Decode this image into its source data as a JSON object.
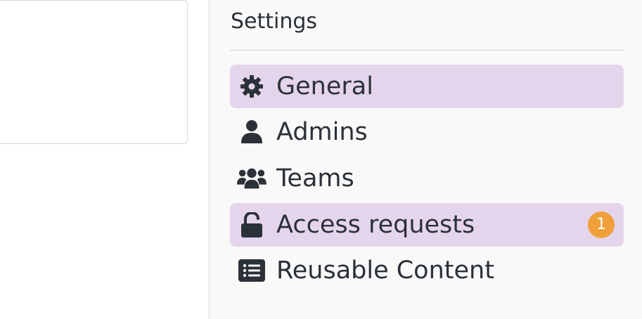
{
  "sidebar": {
    "title": "Settings",
    "items": [
      {
        "label": "General",
        "icon": "gear-icon",
        "active": true
      },
      {
        "label": "Admins",
        "icon": "user-icon",
        "active": false
      },
      {
        "label": "Teams",
        "icon": "users-icon",
        "active": false
      },
      {
        "label": "Access requests",
        "icon": "unlock-icon",
        "active": true,
        "badge": "1"
      },
      {
        "label": "Reusable Content",
        "icon": "list-icon",
        "active": false
      }
    ]
  },
  "colors": {
    "active_background": "#e5d5ec",
    "badge": "#f0a03a",
    "text": "#2b3138"
  }
}
